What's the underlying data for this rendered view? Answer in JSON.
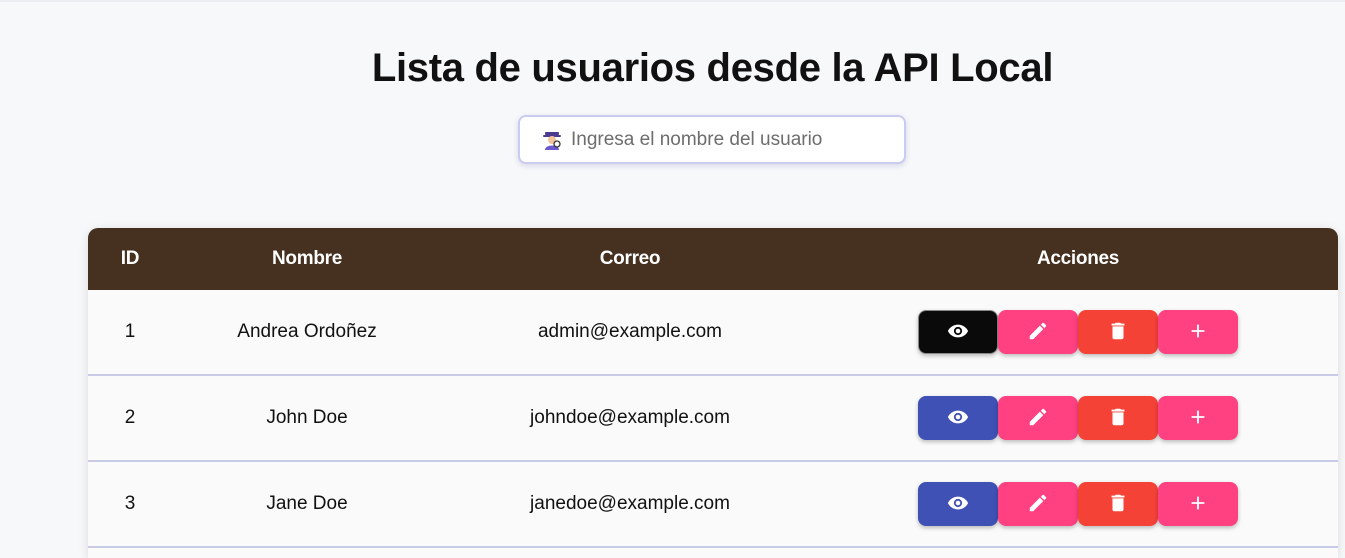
{
  "page": {
    "title": "Lista de usuarios desde la API Local"
  },
  "search": {
    "placeholder": "Ingresa el nombre del usuario",
    "value": "",
    "icon": "detective-emoji-icon"
  },
  "table": {
    "headers": {
      "id": "ID",
      "name": "Nombre",
      "email": "Correo",
      "actions": "Acciones"
    },
    "rows": [
      {
        "id": "1",
        "name": "Andrea Ordoñez",
        "email": "admin@example.com"
      },
      {
        "id": "2",
        "name": "John Doe",
        "email": "johndoe@example.com"
      },
      {
        "id": "3",
        "name": "Jane Doe",
        "email": "janedoe@example.com"
      }
    ],
    "action_icons": [
      "eye-icon",
      "pencil-icon",
      "trash-icon",
      "plus-icon"
    ]
  },
  "colors": {
    "header_bg": "#46301f",
    "view_button": "#3f51b5",
    "view_button_active": "#0a0a0a",
    "edit_button": "#ff4081",
    "delete_button": "#f44336",
    "add_button": "#ff4081"
  }
}
